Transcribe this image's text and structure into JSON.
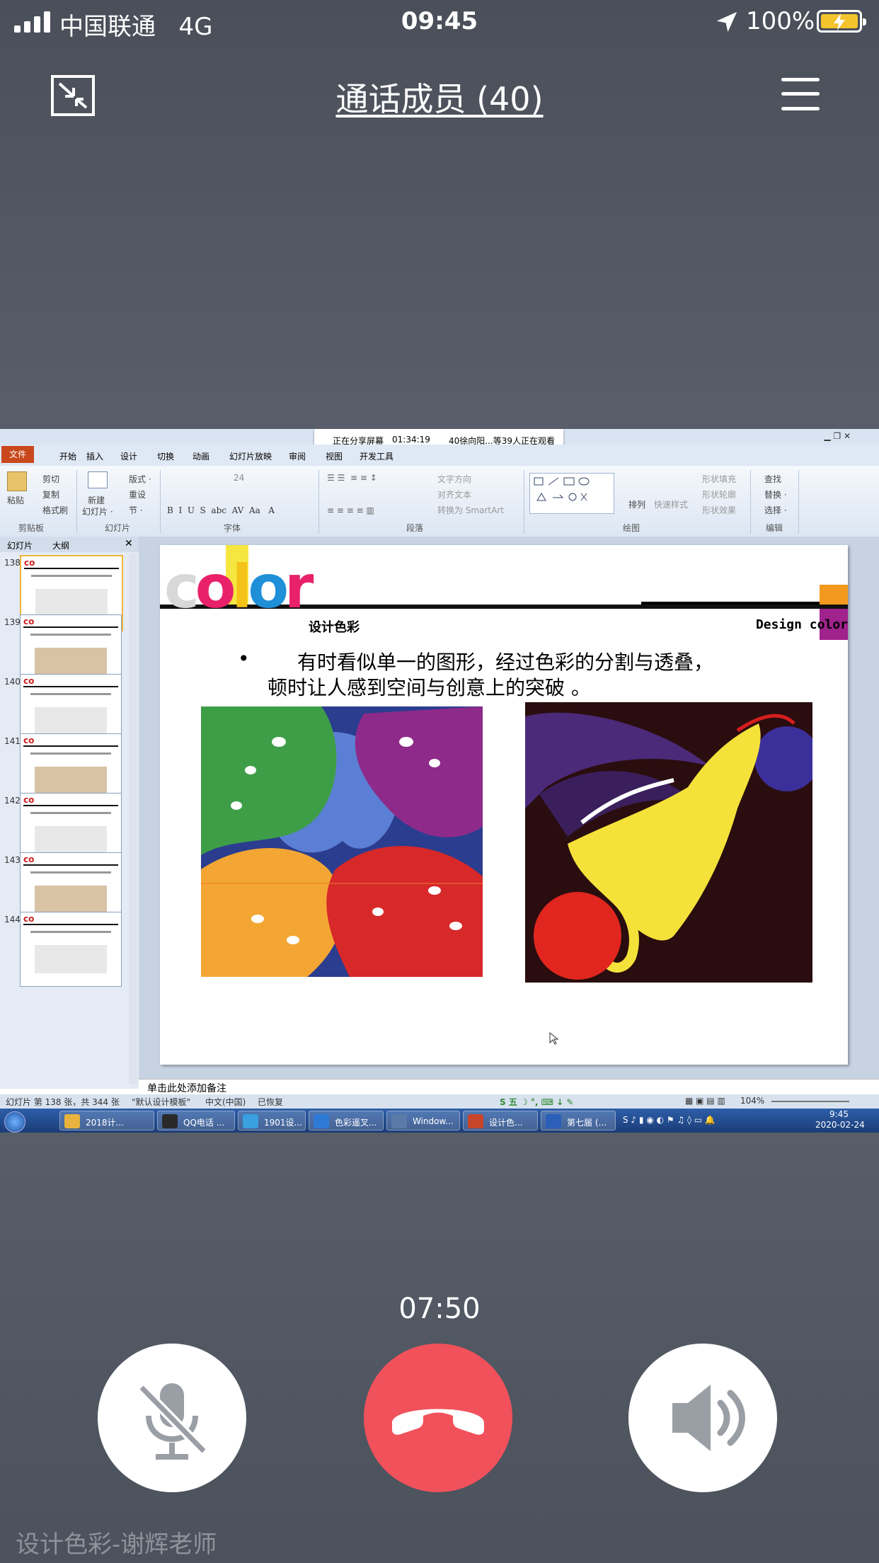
{
  "status_bar": {
    "carrier": "中国联通",
    "network": "4G",
    "time": "09:45",
    "battery": "100%"
  },
  "header": {
    "title": "通话成员 (40)"
  },
  "share": {
    "banner_status": "正在分享屏幕",
    "banner_time": "01:34:19",
    "banner_viewers": "40徐向阳...等39人正在观看",
    "ppt": {
      "tabs": [
        "文件",
        "开始",
        "插入",
        "设计",
        "切换",
        "动画",
        "幻灯片放映",
        "审阅",
        "视图",
        "开发工具"
      ],
      "ribbon_groups": [
        "剪贴板",
        "幻灯片",
        "字体",
        "段落",
        "绘图",
        "编辑"
      ],
      "ribbon_labels": {
        "paste": "粘贴",
        "cut": "剪切",
        "copy": "复制",
        "format_painter": "格式刷",
        "new_slide": "新建",
        "new_slide2": "幻灯片 ·",
        "layout": "版式 ·",
        "reset": "重设",
        "section": "节 ·",
        "font_size": "24",
        "text_direction": "文字方向",
        "align_text": "对齐文本",
        "smartart": "转换为 SmartArt",
        "arrange": "排列",
        "quick_styles": "快速样式",
        "shape_fill": "形状填充",
        "shape_outline": "形状轮廓",
        "shape_effects": "形状效果",
        "find": "查找",
        "replace": "替换 ·",
        "select": "选择 ·"
      },
      "panel_tabs": [
        "幻灯片",
        "大纲"
      ],
      "thumbnails": [
        "138",
        "139",
        "140",
        "141",
        "142",
        "143",
        "144"
      ],
      "slide": {
        "logo": "color",
        "subtitle": "设计色彩",
        "brand_right": "Design color",
        "bullet_line1": "有时看似单一的图形，经过色彩的分割与透叠，",
        "bullet_line2": "顿时让人感到空间与创意上的突破 。"
      },
      "notes_placeholder": "单击此处添加备注",
      "status": {
        "slide_info": "幻灯片 第 138 张，共 344 张",
        "theme": "\"默认设计模板\"",
        "lang": "中文(中国)",
        "recovered": "已恢复",
        "zoom": "104%"
      },
      "taskbar": {
        "items": [
          "2018计...",
          "QQ电话 ...",
          "1901设...",
          "色彩遥叉...",
          "Window...",
          "设计色...",
          "第七届 (..."
        ],
        "time": "9:45",
        "date": "2020-02-24"
      }
    }
  },
  "call": {
    "duration": "07:50"
  },
  "caption": "设计色彩-谢辉老师",
  "colors": {
    "hangup": "#f1515b",
    "battery": "#f4c42c"
  }
}
